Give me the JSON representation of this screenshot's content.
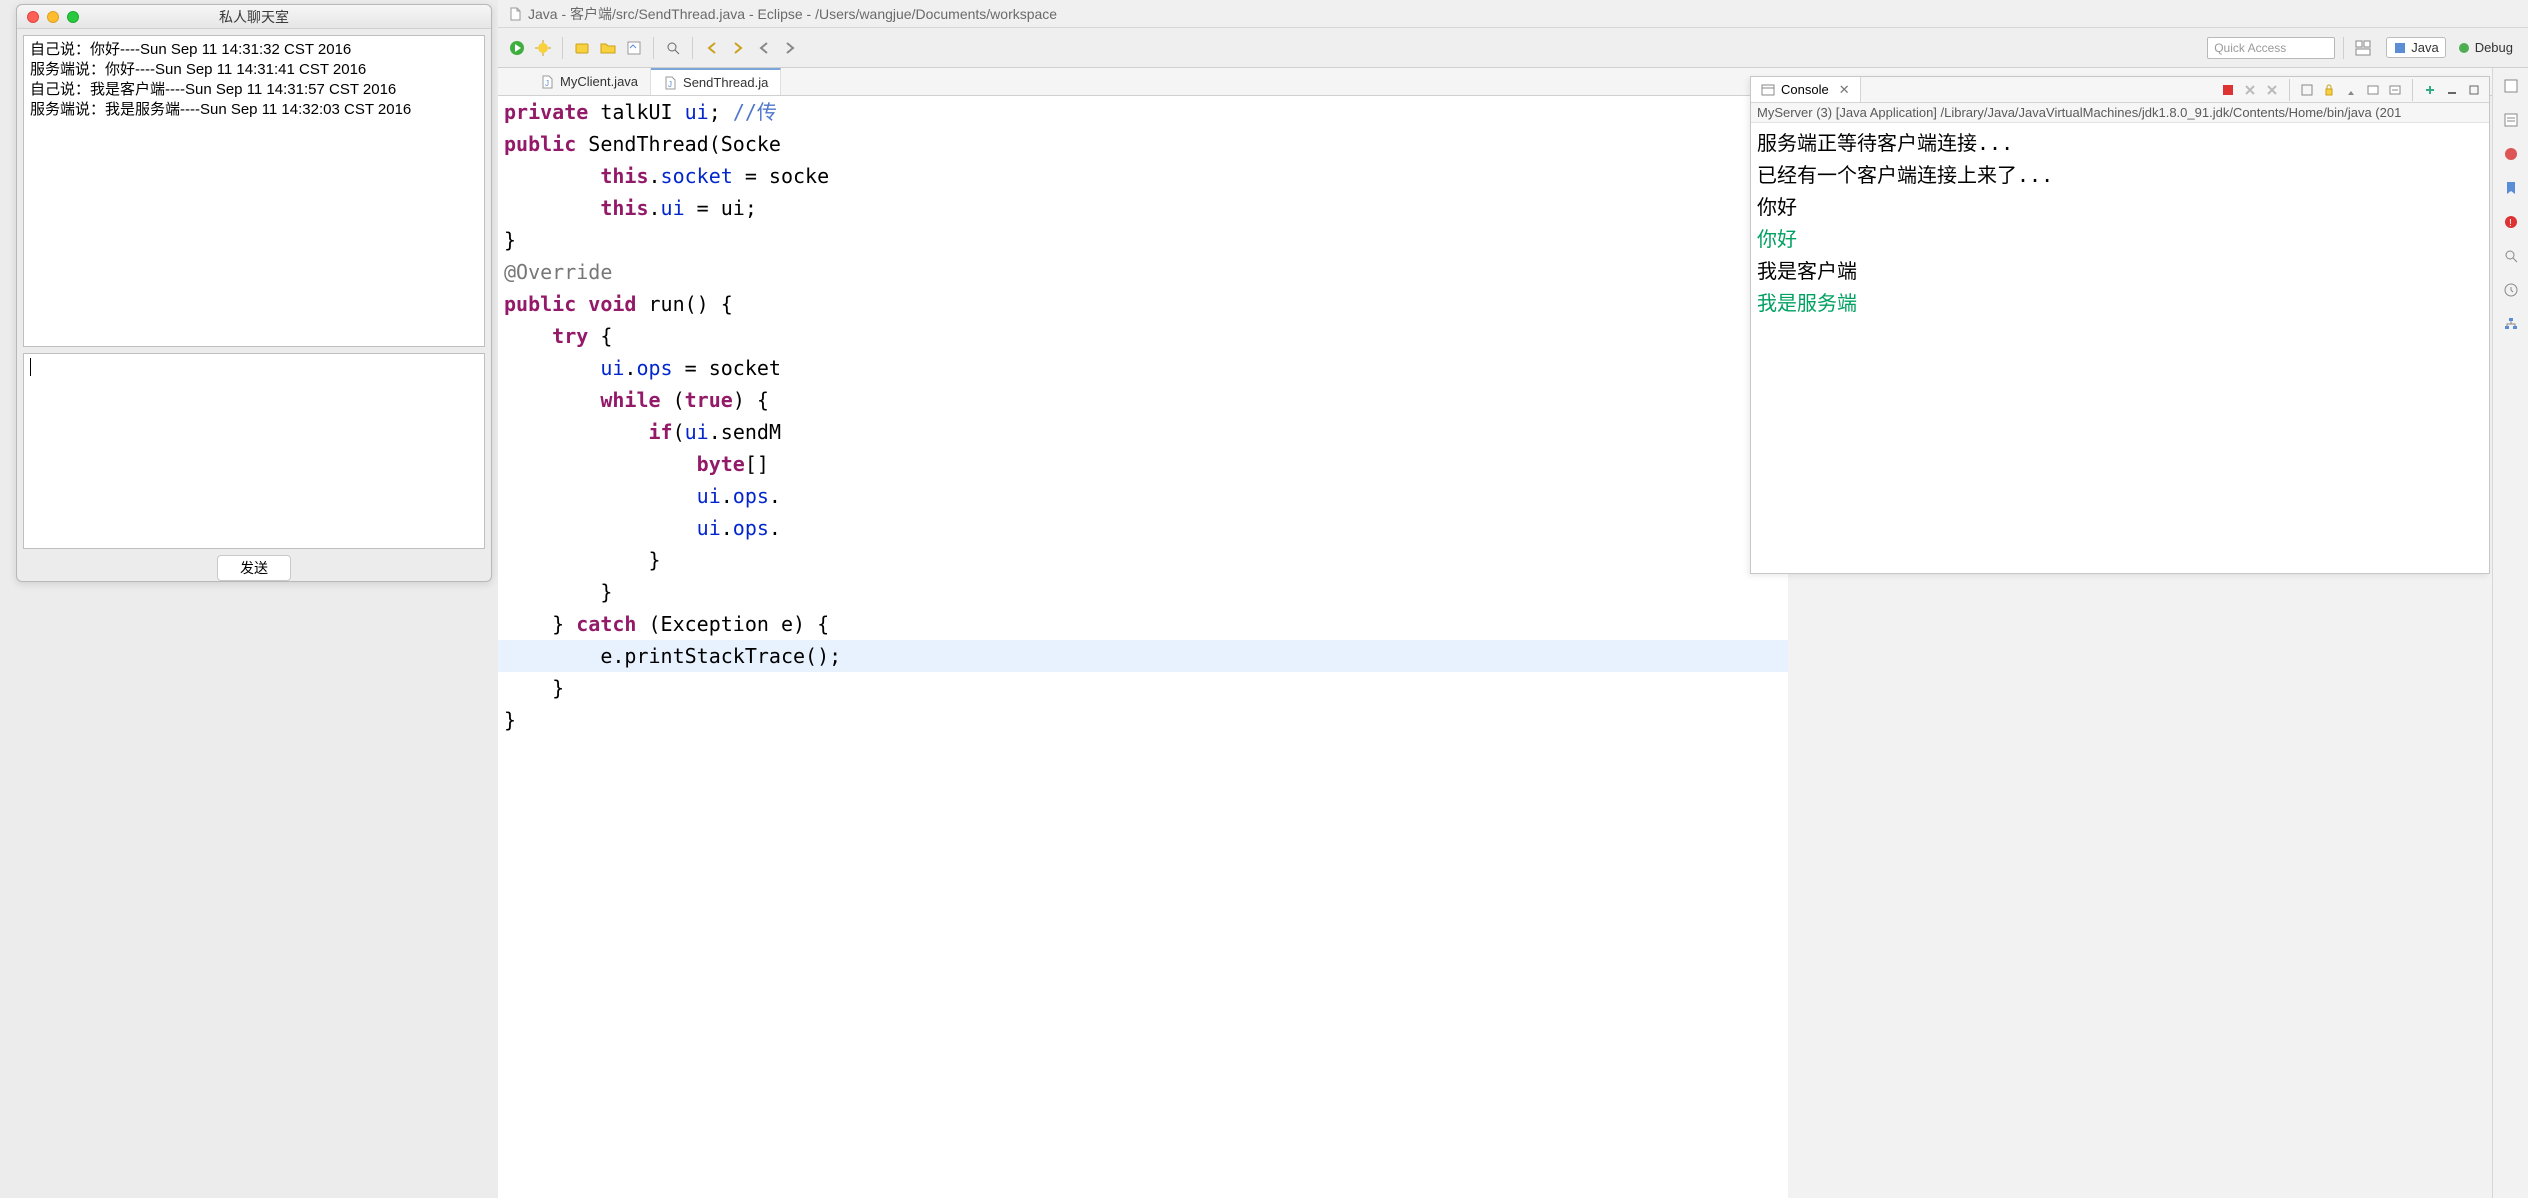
{
  "chat": {
    "title": "私人聊天室",
    "log": [
      "自己说：你好----Sun Sep 11 14:31:32 CST 2016",
      "服务端说：你好----Sun Sep 11 14:31:41 CST 2016",
      "自己说：我是客户端----Sun Sep 11 14:31:57 CST 2016",
      "服务端说：我是服务端----Sun Sep 11 14:32:03 CST 2016"
    ],
    "send_label": "发送"
  },
  "eclipse": {
    "title": "Java - 客户端/src/SendThread.java - Eclipse - /Users/wangjue/Documents/workspace",
    "quick_access_placeholder": "Quick Access",
    "perspectives": {
      "java": "Java",
      "debug": "Debug"
    },
    "tabs": [
      {
        "label": "MyClient.java"
      },
      {
        "label": "SendThread.ja"
      }
    ],
    "code": {
      "l1_a": "private",
      "l1_b": " talkUI ",
      "l1_c": "ui",
      "l1_d": "; ",
      "l1_e": "//传",
      "l2_a": "public",
      "l2_b": " SendThread(Socke",
      "l3_a": "        ",
      "l3_b": "this",
      "l3_c": ".",
      "l3_d": "socket",
      "l3_e": " = socke",
      "l4_a": "        ",
      "l4_b": "this",
      "l4_c": ".",
      "l4_d": "ui",
      "l4_e": " = ui;",
      "l5": "}",
      "l6_a": "@Override",
      "l7_a": "public",
      "l7_b": " ",
      "l7_c": "void",
      "l7_d": " run() {",
      "l8_a": "    ",
      "l8_b": "try",
      "l8_c": " {",
      "l9_a": "        ",
      "l9_b": "ui",
      "l9_c": ".",
      "l9_d": "ops",
      "l9_e": " = socket",
      "l10_a": "        ",
      "l10_b": "while",
      "l10_c": " (",
      "l10_d": "true",
      "l10_e": ") {",
      "l11_a": "            ",
      "l11_b": "if",
      "l11_c": "(",
      "l11_d": "ui",
      "l11_e": ".sendM",
      "l12_a": "                ",
      "l12_b": "byte",
      "l12_c": "[]",
      "l13_a": "                ",
      "l13_b": "ui",
      "l13_c": ".",
      "l13_d": "ops",
      "l13_e": ".",
      "l14_a": "                ",
      "l14_b": "ui",
      "l14_c": ".",
      "l14_d": "ops",
      "l14_e": ".",
      "l15": "            }",
      "l16": "        }",
      "l17_a": "    } ",
      "l17_b": "catch",
      "l17_c": " (Exception e) {",
      "l18": "        e.printStackTrace();",
      "l19": "    }",
      "l20": "}"
    },
    "console": {
      "tab_label": "Console",
      "process": "MyServer (3) [Java Application] /Library/Java/JavaVirtualMachines/jdk1.8.0_91.jdk/Contents/Home/bin/java (201",
      "lines": [
        {
          "text": "服务端正等待客户端连接...",
          "cls": ""
        },
        {
          "text": "已经有一个客户端连接上来了...",
          "cls": ""
        },
        {
          "text": "你好",
          "cls": ""
        },
        {
          "text": "你好",
          "cls": "green"
        },
        {
          "text": "我是客户端",
          "cls": ""
        },
        {
          "text": "我是服务端",
          "cls": "green"
        }
      ]
    }
  }
}
